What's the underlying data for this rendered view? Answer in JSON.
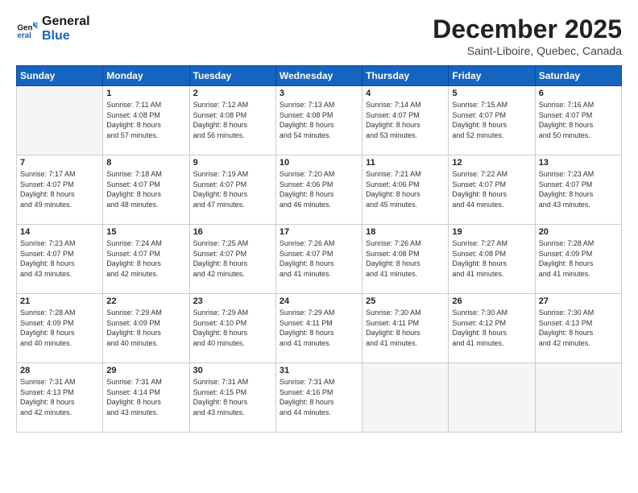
{
  "logo": {
    "line1": "General",
    "line2": "Blue"
  },
  "title": "December 2025",
  "location": "Saint-Liboire, Quebec, Canada",
  "days_of_week": [
    "Sunday",
    "Monday",
    "Tuesday",
    "Wednesday",
    "Thursday",
    "Friday",
    "Saturday"
  ],
  "weeks": [
    [
      {
        "day": "",
        "text": ""
      },
      {
        "day": "1",
        "text": "Sunrise: 7:11 AM\nSunset: 4:08 PM\nDaylight: 8 hours\nand 57 minutes."
      },
      {
        "day": "2",
        "text": "Sunrise: 7:12 AM\nSunset: 4:08 PM\nDaylight: 8 hours\nand 56 minutes."
      },
      {
        "day": "3",
        "text": "Sunrise: 7:13 AM\nSunset: 4:08 PM\nDaylight: 8 hours\nand 54 minutes."
      },
      {
        "day": "4",
        "text": "Sunrise: 7:14 AM\nSunset: 4:07 PM\nDaylight: 8 hours\nand 53 minutes."
      },
      {
        "day": "5",
        "text": "Sunrise: 7:15 AM\nSunset: 4:07 PM\nDaylight: 8 hours\nand 52 minutes."
      },
      {
        "day": "6",
        "text": "Sunrise: 7:16 AM\nSunset: 4:07 PM\nDaylight: 8 hours\nand 50 minutes."
      }
    ],
    [
      {
        "day": "7",
        "text": "Sunrise: 7:17 AM\nSunset: 4:07 PM\nDaylight: 8 hours\nand 49 minutes."
      },
      {
        "day": "8",
        "text": "Sunrise: 7:18 AM\nSunset: 4:07 PM\nDaylight: 8 hours\nand 48 minutes."
      },
      {
        "day": "9",
        "text": "Sunrise: 7:19 AM\nSunset: 4:07 PM\nDaylight: 8 hours\nand 47 minutes."
      },
      {
        "day": "10",
        "text": "Sunrise: 7:20 AM\nSunset: 4:06 PM\nDaylight: 8 hours\nand 46 minutes."
      },
      {
        "day": "11",
        "text": "Sunrise: 7:21 AM\nSunset: 4:06 PM\nDaylight: 8 hours\nand 45 minutes."
      },
      {
        "day": "12",
        "text": "Sunrise: 7:22 AM\nSunset: 4:07 PM\nDaylight: 8 hours\nand 44 minutes."
      },
      {
        "day": "13",
        "text": "Sunrise: 7:23 AM\nSunset: 4:07 PM\nDaylight: 8 hours\nand 43 minutes."
      }
    ],
    [
      {
        "day": "14",
        "text": "Sunrise: 7:23 AM\nSunset: 4:07 PM\nDaylight: 8 hours\nand 43 minutes."
      },
      {
        "day": "15",
        "text": "Sunrise: 7:24 AM\nSunset: 4:07 PM\nDaylight: 8 hours\nand 42 minutes."
      },
      {
        "day": "16",
        "text": "Sunrise: 7:25 AM\nSunset: 4:07 PM\nDaylight: 8 hours\nand 42 minutes."
      },
      {
        "day": "17",
        "text": "Sunrise: 7:26 AM\nSunset: 4:07 PM\nDaylight: 8 hours\nand 41 minutes."
      },
      {
        "day": "18",
        "text": "Sunrise: 7:26 AM\nSunset: 4:08 PM\nDaylight: 8 hours\nand 41 minutes."
      },
      {
        "day": "19",
        "text": "Sunrise: 7:27 AM\nSunset: 4:08 PM\nDaylight: 8 hours\nand 41 minutes."
      },
      {
        "day": "20",
        "text": "Sunrise: 7:28 AM\nSunset: 4:09 PM\nDaylight: 8 hours\nand 41 minutes."
      }
    ],
    [
      {
        "day": "21",
        "text": "Sunrise: 7:28 AM\nSunset: 4:09 PM\nDaylight: 8 hours\nand 40 minutes."
      },
      {
        "day": "22",
        "text": "Sunrise: 7:29 AM\nSunset: 4:09 PM\nDaylight: 8 hours\nand 40 minutes."
      },
      {
        "day": "23",
        "text": "Sunrise: 7:29 AM\nSunset: 4:10 PM\nDaylight: 8 hours\nand 40 minutes."
      },
      {
        "day": "24",
        "text": "Sunrise: 7:29 AM\nSunset: 4:11 PM\nDaylight: 8 hours\nand 41 minutes."
      },
      {
        "day": "25",
        "text": "Sunrise: 7:30 AM\nSunset: 4:11 PM\nDaylight: 8 hours\nand 41 minutes."
      },
      {
        "day": "26",
        "text": "Sunrise: 7:30 AM\nSunset: 4:12 PM\nDaylight: 8 hours\nand 41 minutes."
      },
      {
        "day": "27",
        "text": "Sunrise: 7:30 AM\nSunset: 4:13 PM\nDaylight: 8 hours\nand 42 minutes."
      }
    ],
    [
      {
        "day": "28",
        "text": "Sunrise: 7:31 AM\nSunset: 4:13 PM\nDaylight: 8 hours\nand 42 minutes."
      },
      {
        "day": "29",
        "text": "Sunrise: 7:31 AM\nSunset: 4:14 PM\nDaylight: 8 hours\nand 43 minutes."
      },
      {
        "day": "30",
        "text": "Sunrise: 7:31 AM\nSunset: 4:15 PM\nDaylight: 8 hours\nand 43 minutes."
      },
      {
        "day": "31",
        "text": "Sunrise: 7:31 AM\nSunset: 4:16 PM\nDaylight: 8 hours\nand 44 minutes."
      },
      {
        "day": "",
        "text": ""
      },
      {
        "day": "",
        "text": ""
      },
      {
        "day": "",
        "text": ""
      }
    ]
  ]
}
